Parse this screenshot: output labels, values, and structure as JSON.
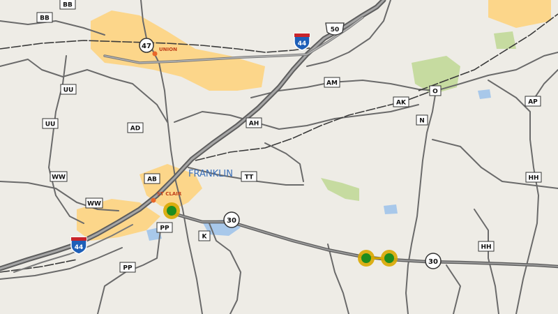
{
  "map": {
    "colors": {
      "background": "#eeece6",
      "urban": "#fcd68a",
      "park": "#c6dba0",
      "water": "#a8c8ea",
      "interstate": "#707070",
      "highway": "#808080",
      "road": "#6a6a6a",
      "railroad": "#3a3a3a",
      "marker_ring": "#d8a800",
      "marker_center": "#1e8c1e",
      "city_dot": "#e8672a",
      "city_label": "#3a6fb8",
      "town_label": "#c0401a"
    },
    "labels": {
      "franklin": "FRANKLIN",
      "union": "UNION",
      "st_clair": "ST CLAIR"
    },
    "shields": {
      "i44_top": "44",
      "i44_bottom": "44",
      "us50": "50",
      "rt47": "47",
      "rt30_mid": "30",
      "rt30_right": "30"
    },
    "routes": {
      "bb": "BB",
      "uu1": "UU",
      "uu2": "UU",
      "ad": "AD",
      "ah": "AH",
      "am": "AM",
      "ak": "AK",
      "o": "O",
      "n": "N",
      "ap": "AP",
      "ww1": "WW",
      "ww2": "WW",
      "ab": "AB",
      "tt": "TT",
      "hh1": "HH",
      "hh2": "HH",
      "pp1": "PP",
      "pp2": "PP",
      "k": "K"
    },
    "markers": [
      "incident",
      "incident",
      "incident"
    ]
  }
}
